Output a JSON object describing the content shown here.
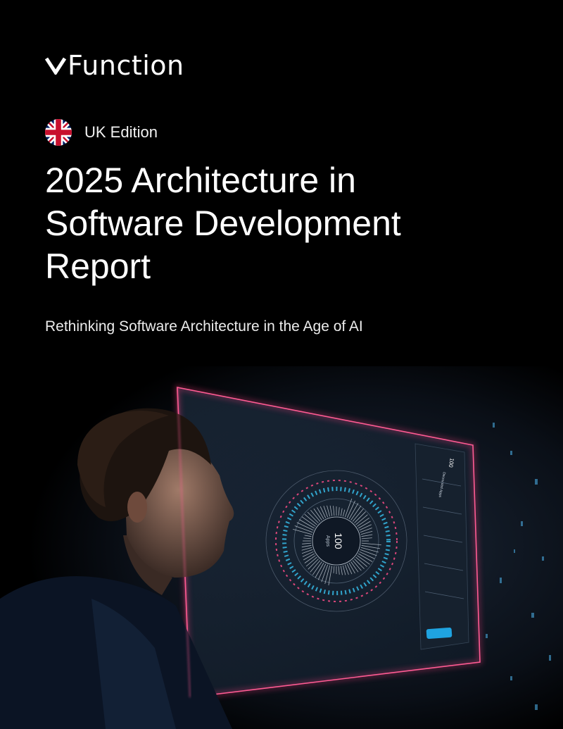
{
  "brand": {
    "name": "Function",
    "icon": "vfunction-logo-v-icon"
  },
  "edition": {
    "label": "UK Edition",
    "icon": "uk-flag-icon"
  },
  "title": {
    "line1": "2025 Architecture in",
    "line2": "Software Development",
    "line3": "Report"
  },
  "subtitle": "Rethinking Software Architecture in the Age of AI",
  "hero": {
    "description_icon": "person-viewing-holographic-dashboard",
    "dashboard": {
      "center_value": "100",
      "center_label": "Apps",
      "panel_header_count": "100",
      "panel_header_label": "Decoupled Apps"
    }
  },
  "colors": {
    "background": "#000000",
    "text": "#ffffff",
    "accent_pink": "#ff3d7f",
    "accent_cyan": "#38c6f4"
  }
}
